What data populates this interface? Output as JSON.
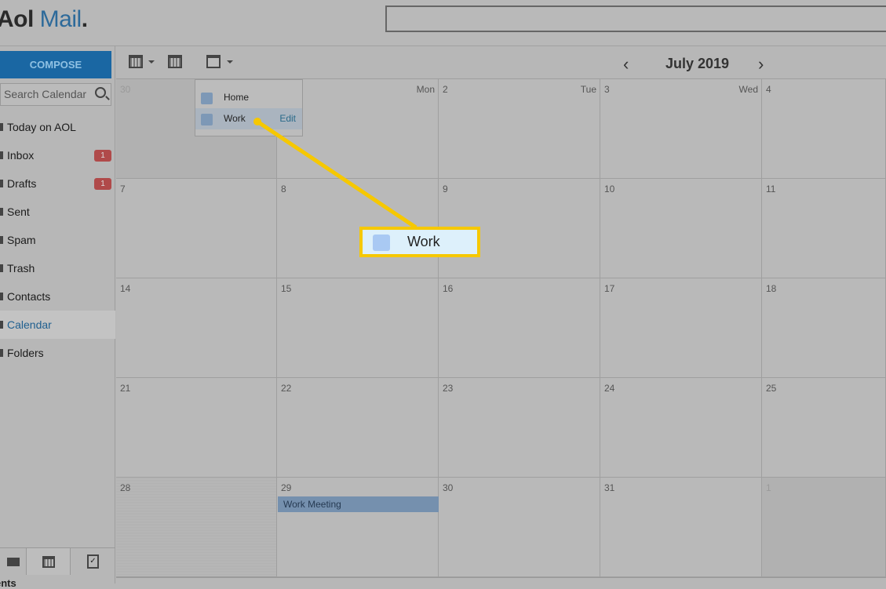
{
  "header": {
    "logo_aol": "Aol",
    "logo_mail": "Mail",
    "logo_dot": "."
  },
  "sidebar": {
    "compose": "COMPOSE",
    "search_placeholder": "Search Calendar",
    "items": [
      {
        "label": "Today on AOL"
      },
      {
        "label": "Inbox",
        "badge": "1"
      },
      {
        "label": "Drafts",
        "badge": "1"
      },
      {
        "label": "Sent"
      },
      {
        "label": "Spam"
      },
      {
        "label": "Trash"
      },
      {
        "label": "Contacts"
      },
      {
        "label": "Calendar",
        "active": true
      },
      {
        "label": "Folders"
      }
    ],
    "footer_label": "ents"
  },
  "toolbar": {
    "month": "July 2019",
    "prev": "‹",
    "next": "›"
  },
  "calendar": {
    "rows": [
      [
        {
          "n": "30",
          "dow": "",
          "other": true
        },
        {
          "n": "",
          "dow": "Mon"
        },
        {
          "n": "2",
          "dow": "Tue"
        },
        {
          "n": "3",
          "dow": "Wed"
        },
        {
          "n": "4"
        }
      ],
      [
        {
          "n": "7"
        },
        {
          "n": "8"
        },
        {
          "n": "9"
        },
        {
          "n": "10"
        },
        {
          "n": "11"
        }
      ],
      [
        {
          "n": "14"
        },
        {
          "n": "15"
        },
        {
          "n": "16"
        },
        {
          "n": "17"
        },
        {
          "n": "18"
        }
      ],
      [
        {
          "n": "21"
        },
        {
          "n": "22"
        },
        {
          "n": "23"
        },
        {
          "n": "24"
        },
        {
          "n": "25"
        }
      ],
      [
        {
          "n": "28"
        },
        {
          "n": "29"
        },
        {
          "n": "30"
        },
        {
          "n": "31"
        },
        {
          "n": "1",
          "other": true
        }
      ]
    ],
    "event": "Work Meeting"
  },
  "popup": {
    "items": [
      {
        "label": "Home"
      },
      {
        "label": "Work",
        "edit": "Edit"
      }
    ]
  },
  "callout": {
    "label": "Work",
    "color": "#f6c800"
  }
}
